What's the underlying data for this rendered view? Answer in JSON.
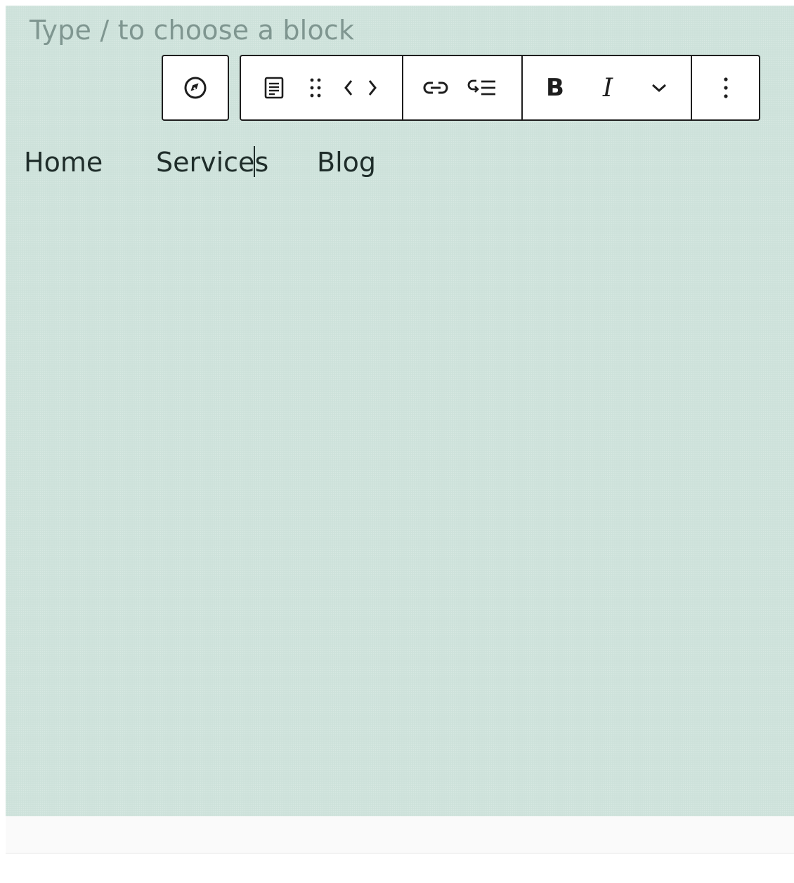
{
  "editor": {
    "placeholder": "Type / to choose a block",
    "background_color": "#cfe3dc"
  },
  "toolbar": {
    "navigation_button": {
      "icon": "compass-icon",
      "label": "Navigation"
    },
    "block_type_button": {
      "icon": "page-list-icon",
      "label": "Block type"
    },
    "drag_handle": {
      "icon": "drag-handle-icon",
      "label": "Drag"
    },
    "move_left": {
      "icon": "chevron-left-icon",
      "label": "Move left"
    },
    "move_right": {
      "icon": "chevron-right-icon",
      "label": "Move right"
    },
    "link_button": {
      "icon": "link-icon",
      "label": "Link"
    },
    "submenu_button": {
      "icon": "add-submenu-icon",
      "label": "Add submenu"
    },
    "bold_label": "B",
    "italic_label": "I",
    "more_formatting": {
      "icon": "chevron-down-icon",
      "label": "More"
    },
    "options_button": {
      "icon": "more-vertical-icon",
      "label": "Options"
    }
  },
  "navigation": {
    "links": [
      {
        "label": "Home"
      },
      {
        "label_before_caret": "Service",
        "label_after_caret": "s"
      },
      {
        "label": "Blog"
      }
    ]
  }
}
